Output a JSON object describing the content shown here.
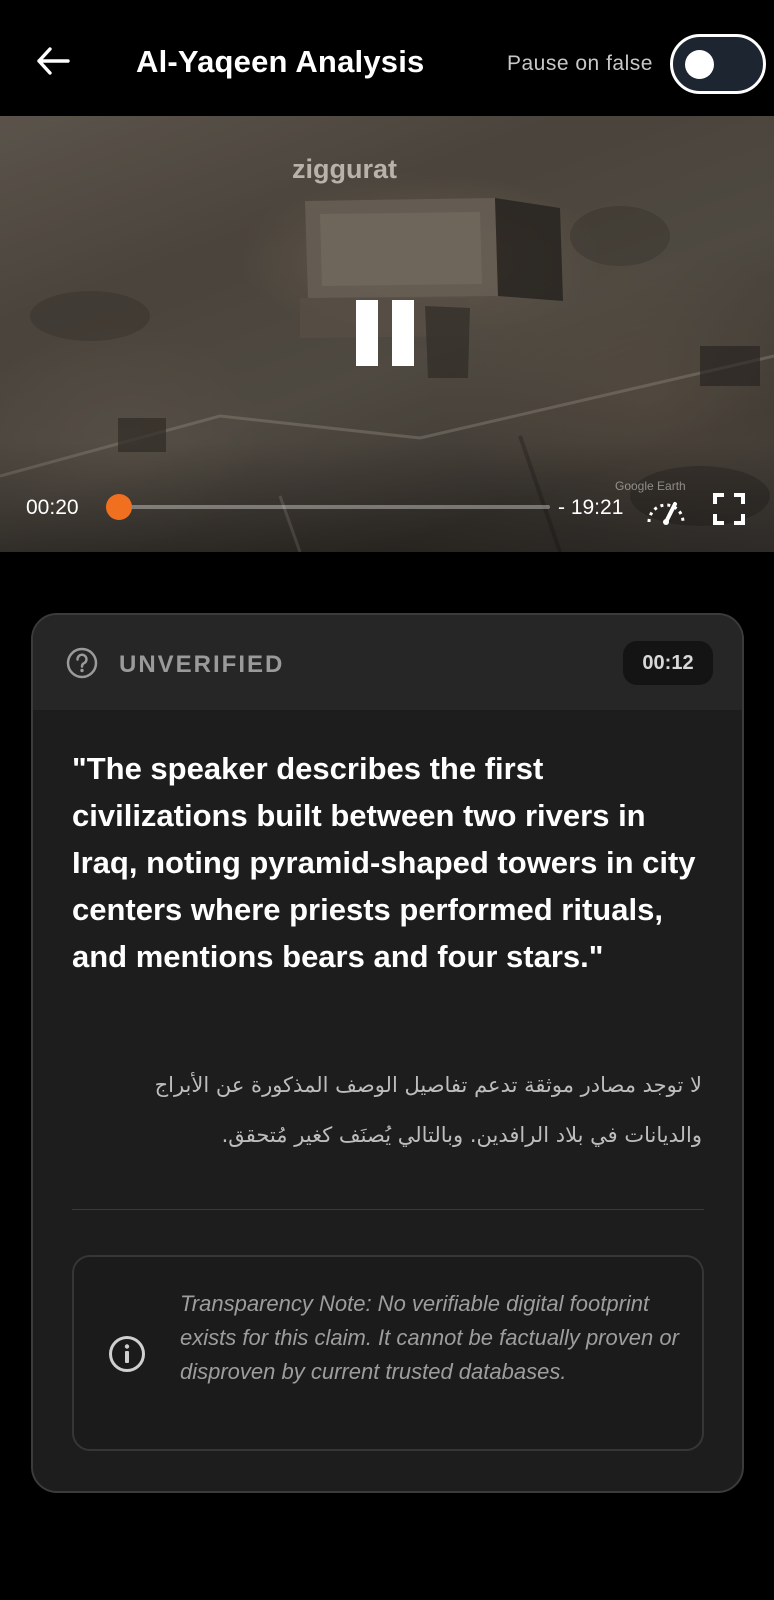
{
  "header": {
    "title": "Al-Yaqeen Analysis",
    "pause_label": "Pause on false",
    "pause_on_false": false
  },
  "video": {
    "overlay_label": "ziggurat",
    "watermark": "Google Earth",
    "current_time": "00:20",
    "remaining_time": "- 19:21",
    "progress_fraction": 0.017,
    "accent_color": "#f07020"
  },
  "card": {
    "status": "UNVERIFIED",
    "status_icon": "question-circle-icon",
    "timestamp": "00:12",
    "claim": "\"The speaker describes the first civilizations built between two rivers in Iraq, noting pyramid-shaped towers in city centers where priests performed rituals, and mentions bears and four stars.\"",
    "arabic_explanation": "لا توجد مصادر موثقة تدعم تفاصيل الوصف المذكورة عن الأبراج والديانات في بلاد الرافدين. وبالتالي يُصنَف كغير مُتحقق.",
    "note_icon": "info-circle-icon",
    "transparency_note": "Transparency Note: No verifiable digital footprint exists for this claim. It cannot be factually proven or disproven by current trusted databases."
  }
}
